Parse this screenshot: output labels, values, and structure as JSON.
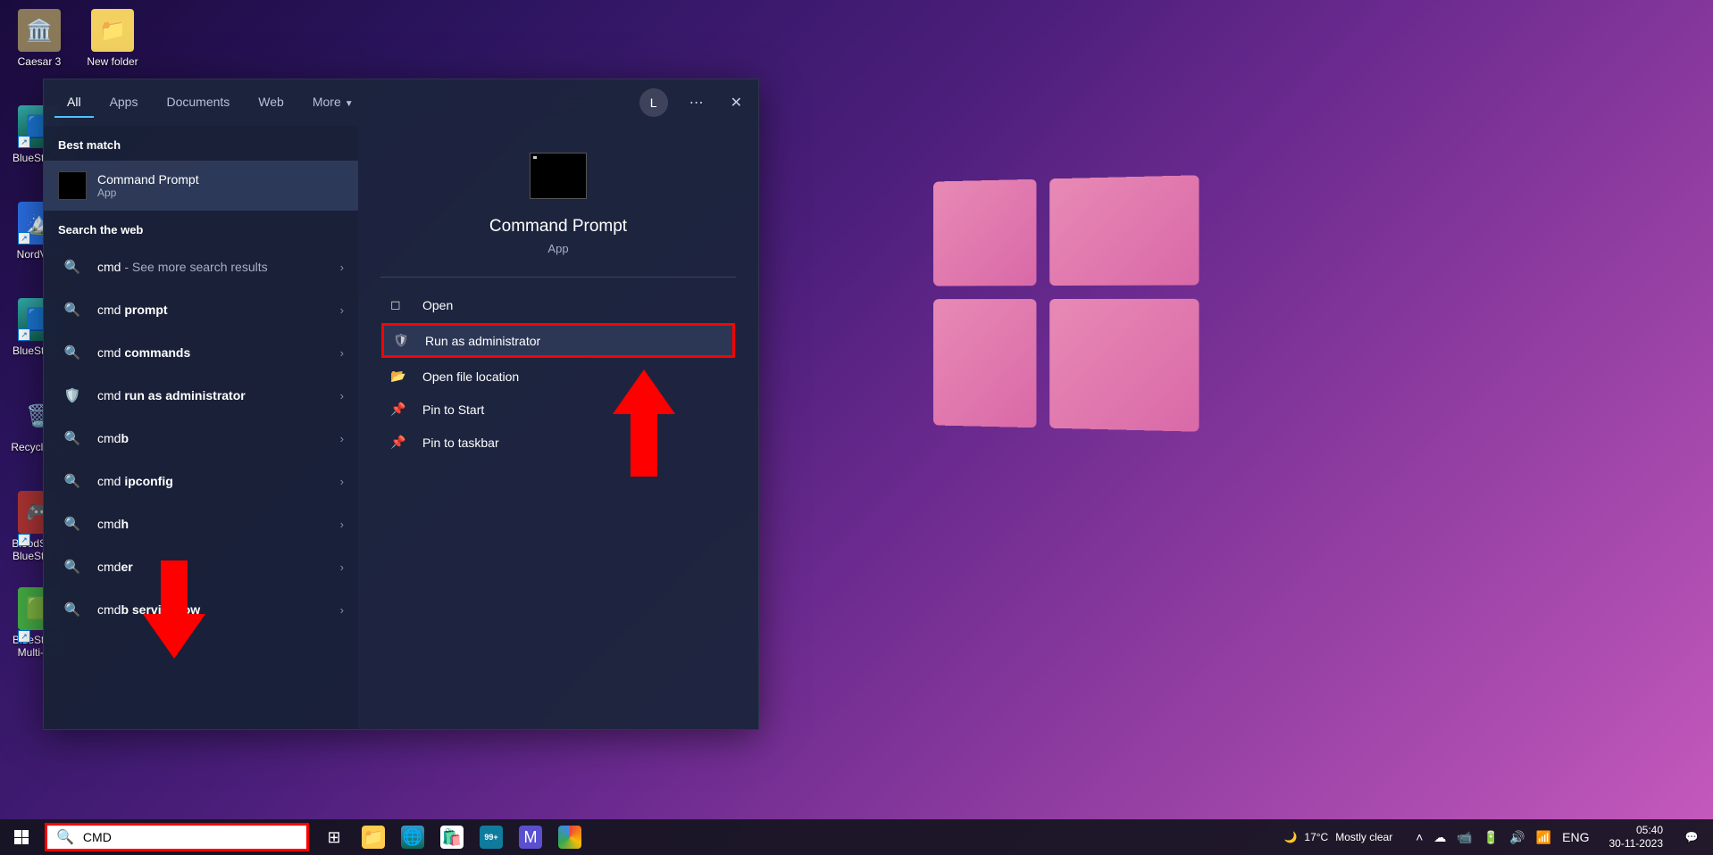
{
  "desktop": {
    "icons": [
      {
        "label": "Caesar 3",
        "emoji": "🏛️"
      },
      {
        "label": "New folder",
        "emoji": "📁"
      },
      {
        "label": "BlueStacks",
        "emoji": "🟦"
      },
      {
        "label": "NordVPN",
        "emoji": "🔵"
      },
      {
        "label": "BlueStacks",
        "emoji": "🟦"
      },
      {
        "label": "Recycle Bin",
        "emoji": "🗑️"
      },
      {
        "label": "BloodStrike BlueStacks",
        "emoji": "🎮"
      },
      {
        "label": "BlueStacks Multi-Inst",
        "emoji": "🟩"
      }
    ]
  },
  "search": {
    "tabs": [
      "All",
      "Apps",
      "Documents",
      "Web",
      "More"
    ],
    "avatar_initial": "L",
    "section_best": "Best match",
    "section_web": "Search the web",
    "best_match": {
      "title": "Command Prompt",
      "sub": "App"
    },
    "web_results": [
      {
        "prefix": "cmd",
        "bold": "",
        "suffix": " - See more search results"
      },
      {
        "prefix": "cmd ",
        "bold": "prompt",
        "suffix": ""
      },
      {
        "prefix": "cmd ",
        "bold": "commands",
        "suffix": ""
      },
      {
        "prefix": "cmd ",
        "bold": "run as administrator",
        "suffix": ""
      },
      {
        "prefix": "cmd",
        "bold": "b",
        "suffix": ""
      },
      {
        "prefix": "cmd ",
        "bold": "ipconfig",
        "suffix": ""
      },
      {
        "prefix": "cmd",
        "bold": "h",
        "suffix": ""
      },
      {
        "prefix": "cmd",
        "bold": "er",
        "suffix": ""
      },
      {
        "prefix": "cmd",
        "bold": "b servicenow",
        "suffix": ""
      }
    ],
    "preview": {
      "title": "Command Prompt",
      "sub": "App",
      "actions": [
        "Open",
        "Run as administrator",
        "Open file location",
        "Pin to Start",
        "Pin to taskbar"
      ]
    }
  },
  "taskbar": {
    "search_value": "CMD",
    "weather_temp": "17°C",
    "weather_desc": "Mostly clear",
    "lang": "ENG",
    "time": "05:40",
    "date": "30-11-2023",
    "badge": "99+"
  }
}
